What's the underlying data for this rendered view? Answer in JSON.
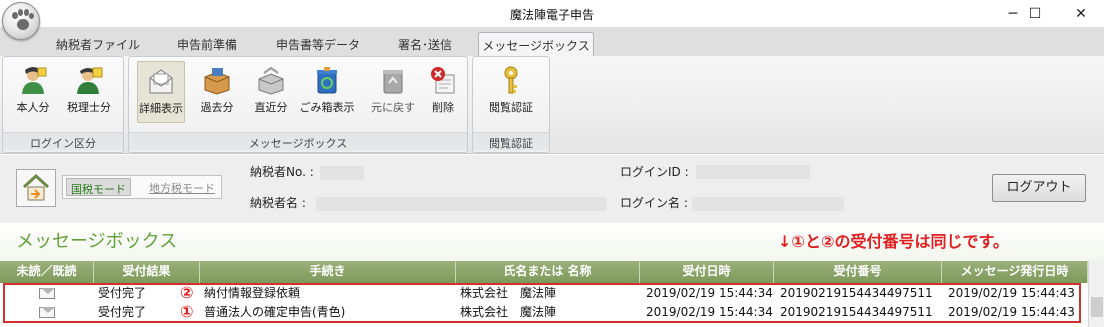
{
  "window": {
    "title": "魔法陣電子申告",
    "controls": {
      "minimize": "─",
      "maximize": "☐",
      "close": "✕"
    }
  },
  "tabs": [
    {
      "label": "納税者ファイル"
    },
    {
      "label": "申告前準備"
    },
    {
      "label": "申告書等データ"
    },
    {
      "label": "署名･送信"
    },
    {
      "label": "メッセージボックス",
      "active": true
    }
  ],
  "ribbon": {
    "login_group": {
      "label": "ログイン区分",
      "buttons": [
        {
          "label": "本人分",
          "icon": "user-icon"
        },
        {
          "label": "税理士分",
          "icon": "tax-accountant-icon"
        }
      ]
    },
    "message_group": {
      "label": "メッセージボックス",
      "buttons": [
        {
          "label": "詳細表示",
          "icon": "detail-view-icon",
          "selected": true
        },
        {
          "label": "過去分",
          "icon": "past-box-icon"
        },
        {
          "label": "直近分",
          "icon": "recent-box-icon"
        },
        {
          "label": "ごみ箱表示",
          "icon": "recycle-bin-icon"
        },
        {
          "label": "元に戻す",
          "icon": "restore-icon"
        },
        {
          "label": "削除",
          "icon": "delete-icon"
        }
      ]
    },
    "auth_group": {
      "label": "閲覧認証",
      "buttons": [
        {
          "label": "閲覧認証",
          "icon": "key-icon"
        }
      ]
    }
  },
  "info": {
    "mode_active": "国税モード",
    "mode_inactive": "地方税モード",
    "taxpayer_no_label": "納税者No. :",
    "taxpayer_name_label": "納税者名 :",
    "login_id_label": "ログインID :",
    "login_name_label": "ログイン名 :",
    "logout_label": "ログアウト"
  },
  "section": {
    "title": "メッセージボックス",
    "note": "↓①と②の受付番号は同じです。"
  },
  "table": {
    "columns": [
      "未読／既読",
      "受付結果",
      "手続き",
      "氏名または 名称",
      "受付日時",
      "受付番号",
      "メッセージ発行日時"
    ],
    "rows": [
      {
        "marker": "②",
        "result": "受付完了",
        "procedure": "納付情報登録依頼",
        "name": "株式会社　魔法陣",
        "received": "2019/02/19 15:44:34",
        "number": "20190219154434497511",
        "issued": "2019/02/19 15:44:43"
      },
      {
        "marker": "①",
        "result": "受付完了",
        "procedure": "普通法人の確定申告(青色)",
        "name": "株式会社　魔法陣",
        "received": "2019/02/19 15:44:34",
        "number": "20190219154434497511",
        "issued": "2019/02/19 15:44:43"
      }
    ]
  },
  "colors": {
    "accent_green": "#62a23a",
    "header_green": "#8aa567",
    "annotation_red": "#e02020"
  }
}
